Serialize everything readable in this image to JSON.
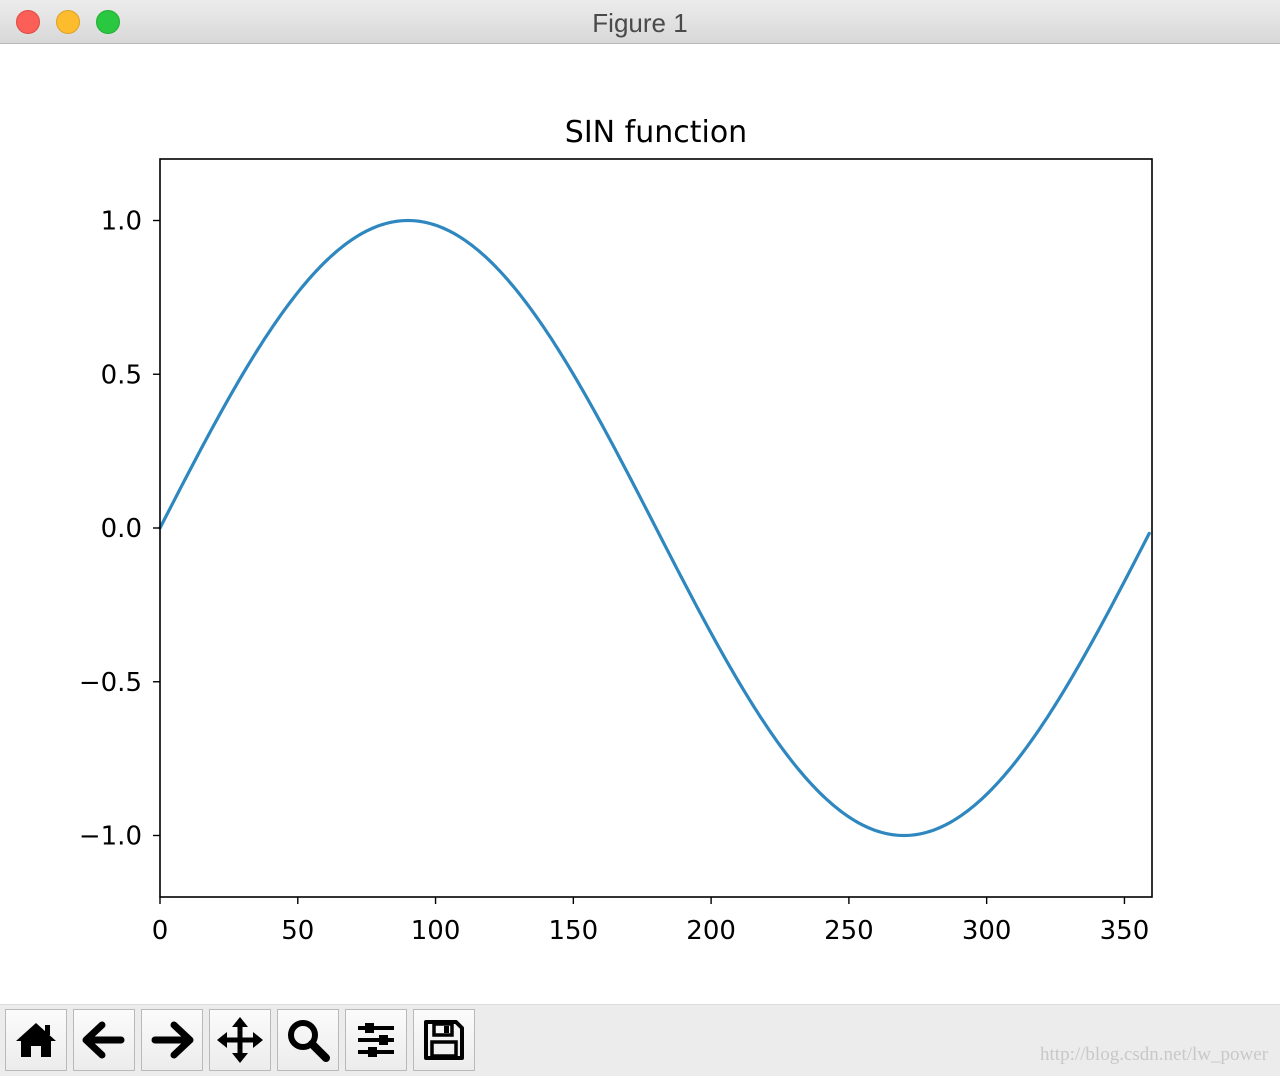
{
  "window": {
    "title": "Figure 1"
  },
  "toolbar": {
    "buttons": [
      {
        "name": "home-button",
        "icon": "home-icon"
      },
      {
        "name": "back-button",
        "icon": "arrow-left-icon"
      },
      {
        "name": "forward-button",
        "icon": "arrow-right-icon"
      },
      {
        "name": "pan-button",
        "icon": "move-icon"
      },
      {
        "name": "zoom-button",
        "icon": "magnifier-icon"
      },
      {
        "name": "configure-subplots-button",
        "icon": "sliders-icon"
      },
      {
        "name": "save-button",
        "icon": "floppy-disk-icon"
      }
    ]
  },
  "watermark": "http://blog.csdn.net/lw_power",
  "colors": {
    "line": "#2e88bf",
    "titlebar": "#e2e2e2",
    "toolbar": "#ececec"
  },
  "chart_data": {
    "type": "line",
    "title": "SIN function",
    "xlabel": "",
    "ylabel": "",
    "function": "sin(x degrees)",
    "x_range": [
      0,
      359
    ],
    "xlim": [
      0,
      360
    ],
    "ylim": [
      -1.2,
      1.2
    ],
    "x_ticks": [
      0,
      50,
      100,
      150,
      200,
      250,
      300,
      350
    ],
    "x_tick_labels": [
      "0",
      "50",
      "100",
      "150",
      "200",
      "250",
      "300",
      "350"
    ],
    "y_ticks": [
      1.0,
      0.5,
      0.0,
      -0.5,
      -1.0
    ],
    "y_tick_labels": [
      "1.0",
      "0.5",
      "0.0",
      "−0.5",
      "−1.0"
    ],
    "grid": false,
    "series": [
      {
        "x": [
          0,
          30,
          60,
          90,
          120,
          150,
          180,
          210,
          240,
          270,
          300,
          330,
          359
        ],
        "values": [
          0.0,
          0.5,
          0.866,
          1.0,
          0.866,
          0.5,
          0.0,
          -0.5,
          -0.866,
          -1.0,
          -0.866,
          -0.5,
          -0.017
        ]
      }
    ]
  }
}
